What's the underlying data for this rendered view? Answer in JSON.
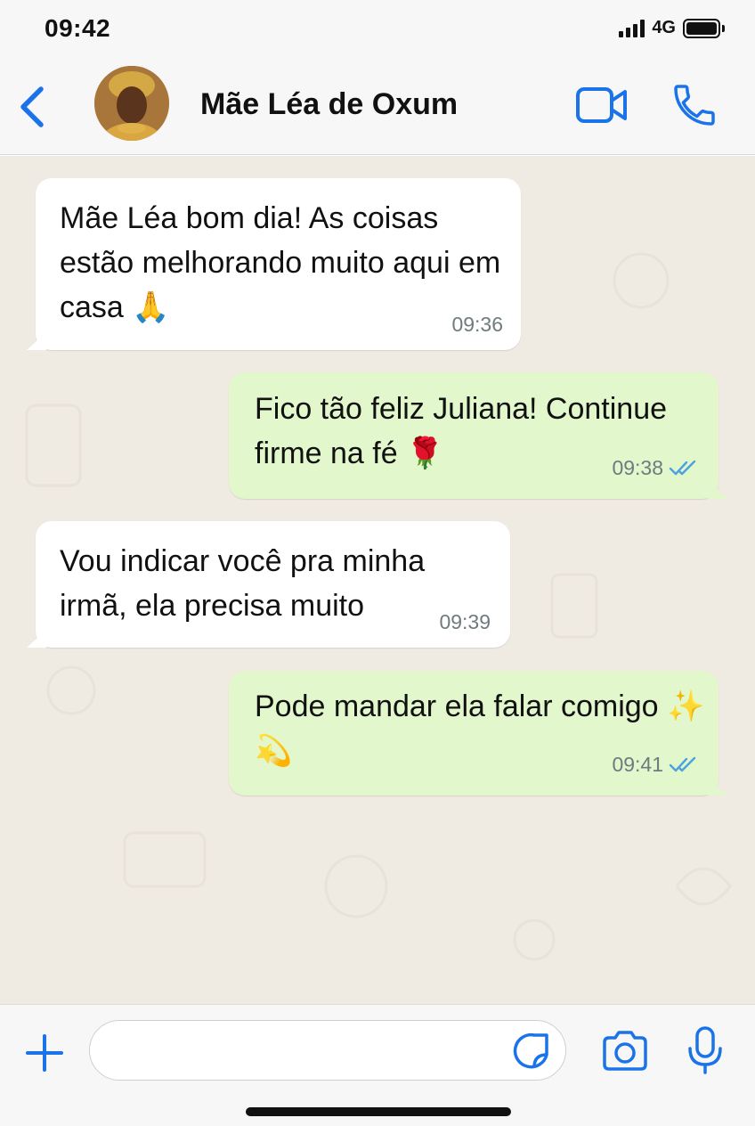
{
  "status_bar": {
    "time": "09:42",
    "network": "4G",
    "signal_icon": "signal-bars-icon",
    "battery_icon": "battery-icon"
  },
  "header": {
    "contact_name": "Mãe Léa de Oxum",
    "back_icon": "chevron-left-icon",
    "video_icon": "video-camera-icon",
    "call_icon": "phone-icon"
  },
  "messages": [
    {
      "direction": "incoming",
      "text": "Mãe Léa bom dia! As coisas estão melhorando muito aqui em casa 🙏",
      "time": "09:36"
    },
    {
      "direction": "outgoing",
      "text": "Fico tão feliz Juliana! Continue firme na fé 🌹",
      "time": "09:38",
      "status": "read"
    },
    {
      "direction": "incoming",
      "text": "Vou indicar você pra minha irmã, ela precisa muito",
      "time": "09:39"
    },
    {
      "direction": "outgoing",
      "text": "Pode mandar ela falar comigo ✨💫",
      "time": "09:41",
      "status": "read"
    }
  ],
  "composer": {
    "placeholder": "",
    "value": "",
    "icons": [
      "plus-icon",
      "sticker-icon",
      "camera-icon",
      "microphone-icon"
    ]
  },
  "colors": {
    "accent": "#1a73e8",
    "incoming_bubble": "#ffffff",
    "outgoing_bubble": "#e2f7cb",
    "chat_background": "#efeae2",
    "read_ticks": "#4aa3df"
  }
}
